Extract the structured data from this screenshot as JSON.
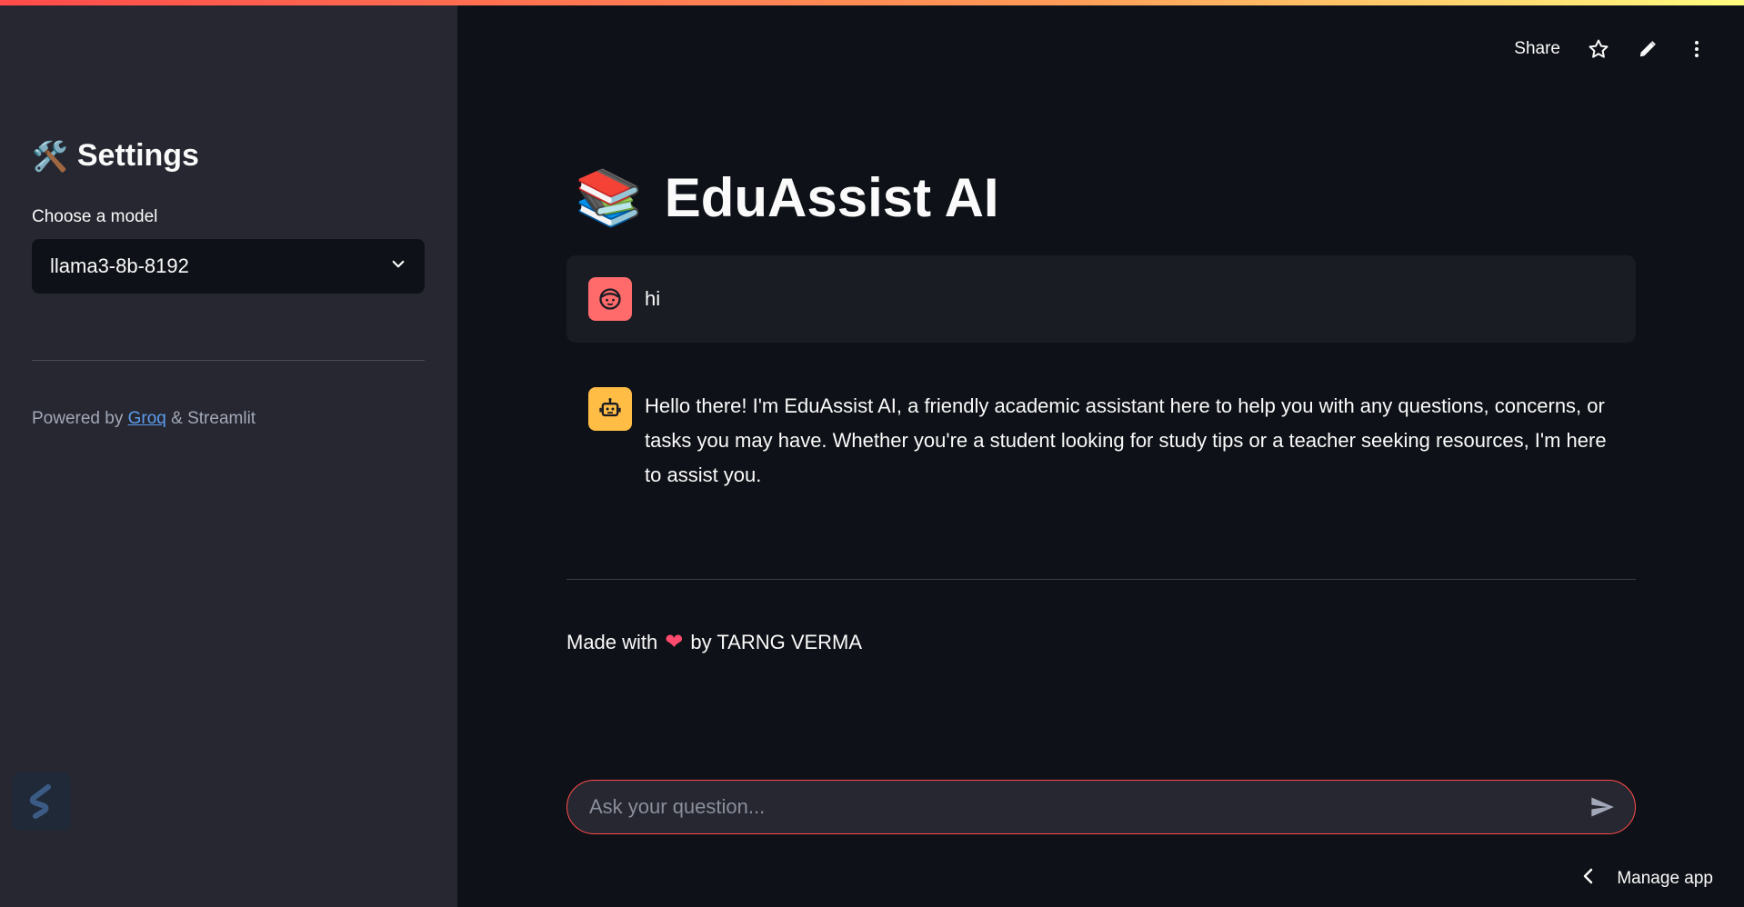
{
  "sidebar": {
    "title_emoji": "🛠️",
    "title": "Settings",
    "model_label": "Choose a model",
    "model_value": "llama3-8b-8192",
    "powered_prefix": "Powered by ",
    "powered_link": "Groq",
    "powered_suffix": " & Streamlit"
  },
  "toolbar": {
    "share": "Share"
  },
  "main": {
    "title_emoji": "📚",
    "title": "EduAssist AI",
    "messages": [
      {
        "role": "user",
        "text": "hi"
      },
      {
        "role": "assistant",
        "text": "Hello there! I'm EduAssist AI, a friendly academic assistant here to help you with any questions, concerns, or tasks you may have. Whether you're a student looking for study tips or a teacher seeking resources, I'm here to assist you."
      }
    ],
    "footer_prefix": "Made with",
    "footer_heart": "❤",
    "footer_suffix": "by TARNG VERMA"
  },
  "chat_input": {
    "placeholder": "Ask your question..."
  },
  "manage_app": "Manage app",
  "colors": {
    "accent": "#ff4b4b",
    "user_avatar": "#ff6b6b",
    "bot_avatar": "#ffbd45"
  }
}
